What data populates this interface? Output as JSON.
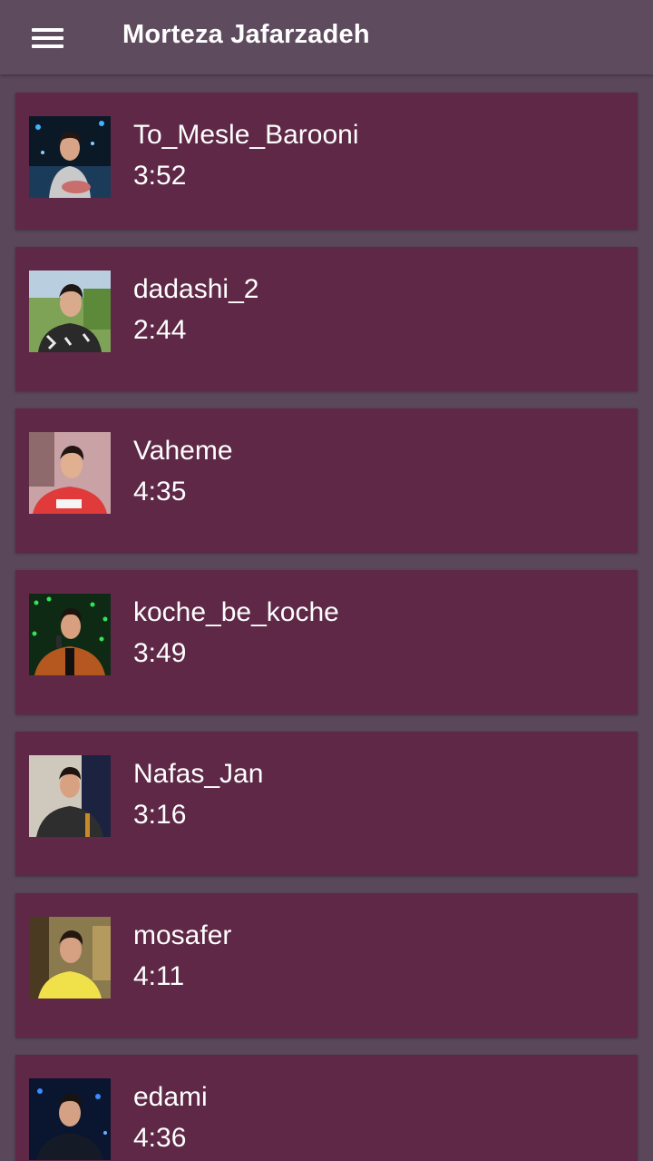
{
  "appbar": {
    "title": "Morteza Jafarzadeh",
    "menu_icon": "hamburger-menu-icon"
  },
  "colors": {
    "background": "#5a485a",
    "appbar": "#5e4b5e",
    "card": "#5e2846",
    "text": "#ffffff"
  },
  "songs": [
    {
      "name": "To_Mesle_Barooni",
      "duration": "3:52",
      "thumb": "artist-photo"
    },
    {
      "name": "dadashi_2",
      "duration": "2:44",
      "thumb": "artist-photo"
    },
    {
      "name": "Vaheme",
      "duration": "4:35",
      "thumb": "artist-photo"
    },
    {
      "name": "koche_be_koche",
      "duration": "3:49",
      "thumb": "artist-photo"
    },
    {
      "name": "Nafas_Jan",
      "duration": "3:16",
      "thumb": "artist-photo"
    },
    {
      "name": "mosafer",
      "duration": "4:11",
      "thumb": "artist-photo"
    },
    {
      "name": "edami",
      "duration": "4:36",
      "thumb": "artist-photo"
    }
  ]
}
